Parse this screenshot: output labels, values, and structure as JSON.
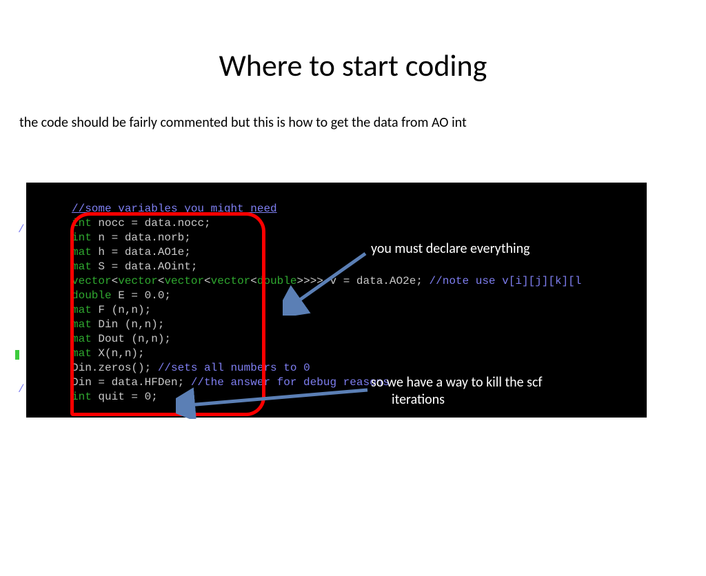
{
  "title": "Where to start coding",
  "subtitle": "the code should be fairly commented but this is how to get the data from AO int",
  "code": {
    "l1": "//some variables you might need",
    "l2a": "int",
    "l2b": " nocc = data.nocc;",
    "l3a": "int",
    "l3b": " n = data.norb;",
    "l4a": "mat",
    "l4b": " h = data.AO1e;",
    "l5a": "mat",
    "l5b": " S = data.AOint;",
    "l6a": "vector",
    "l6b": "<",
    "l6c": "vector",
    "l6d": "<",
    "l6e": "vector",
    "l6f": "<",
    "l6g": "vector",
    "l6h": "<",
    "l6i": "double",
    "l6j": ">>>> v = data.AO2e; ",
    "l6k": "//note use v[i][j][k][l",
    "l7a": "double",
    "l7b": " E = 0.0;",
    "l8a": "mat",
    "l8b": " F (n,n);",
    "l9a": "mat",
    "l9b": " Din (n,n);",
    "l10a": "mat",
    "l10b": " Dout (n,n);",
    "l11a": "mat",
    "l11b": " X(n,n);",
    "l12a": "Din.zeros(); ",
    "l12b": "//sets all numbers to 0",
    "l13a": "Din = data.HFDen; ",
    "l13b": "//the answer for debug reasons",
    "l14a": "int",
    "l14b": " quit = 0;"
  },
  "annotations": {
    "a1": "you must declare everything",
    "a2_line1": "so we have a way to kill the scf",
    "a2_line2": "iterations"
  }
}
